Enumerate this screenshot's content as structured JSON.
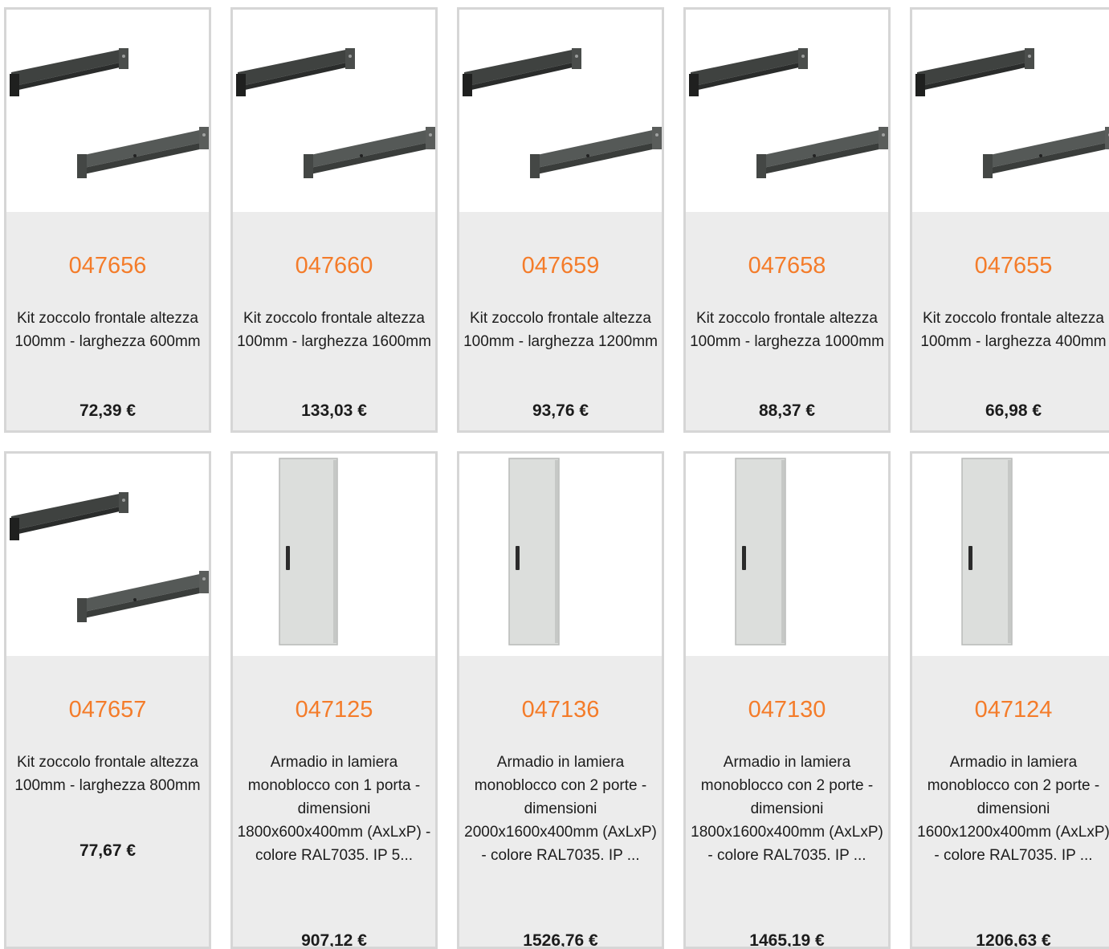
{
  "products": [
    {
      "code": "047656",
      "description": "Kit zoccolo frontale altezza 100mm - larghezza 600mm",
      "price": "72,39 €",
      "image_icon": "plinth-kit-icon"
    },
    {
      "code": "047660",
      "description": "Kit zoccolo frontale altezza 100mm - larghezza 1600mm",
      "price": "133,03 €",
      "image_icon": "plinth-kit-icon"
    },
    {
      "code": "047659",
      "description": "Kit zoccolo frontale altezza 100mm - larghezza 1200mm",
      "price": "93,76 €",
      "image_icon": "plinth-kit-icon"
    },
    {
      "code": "047658",
      "description": "Kit zoccolo frontale altezza 100mm - larghezza 1000mm",
      "price": "88,37 €",
      "image_icon": "plinth-kit-icon"
    },
    {
      "code": "047655",
      "description": "Kit zoccolo frontale altezza 100mm - larghezza 400mm",
      "price": "66,98 €",
      "image_icon": "plinth-kit-icon"
    },
    {
      "code": "047657",
      "description": "Kit zoccolo frontale altezza 100mm - larghezza 800mm",
      "price": "77,67 €",
      "image_icon": "plinth-kit-icon"
    },
    {
      "code": "047125",
      "description": "Armadio in lamiera monoblocco con 1 porta - dimensioni 1800x600x400mm (AxLxP) - colore RAL7035. IP 5...",
      "price": "907,12 €",
      "image_icon": "cabinet-icon"
    },
    {
      "code": "047136",
      "description": "Armadio in lamiera monoblocco con 2 porte - dimensioni 2000x1600x400mm (AxLxP) - colore RAL7035. IP ...",
      "price": "1526,76 €",
      "image_icon": "cabinet-icon"
    },
    {
      "code": "047130",
      "description": "Armadio in lamiera monoblocco con 2 porte - dimensioni 1800x1600x400mm (AxLxP) - colore RAL7035. IP ...",
      "price": "1465,19 €",
      "image_icon": "cabinet-icon"
    },
    {
      "code": "047124",
      "description": "Armadio in lamiera monoblocco con 2 porte - dimensioni 1600x1200x400mm (AxLxP) - colore RAL7035. IP ...",
      "price": "1206,63 €",
      "image_icon": "cabinet-icon"
    }
  ],
  "colors": {
    "code": "#f47c2a",
    "card_bg": "#ececec",
    "card_border": "#d6d6d6",
    "text": "#1c1c1c"
  }
}
